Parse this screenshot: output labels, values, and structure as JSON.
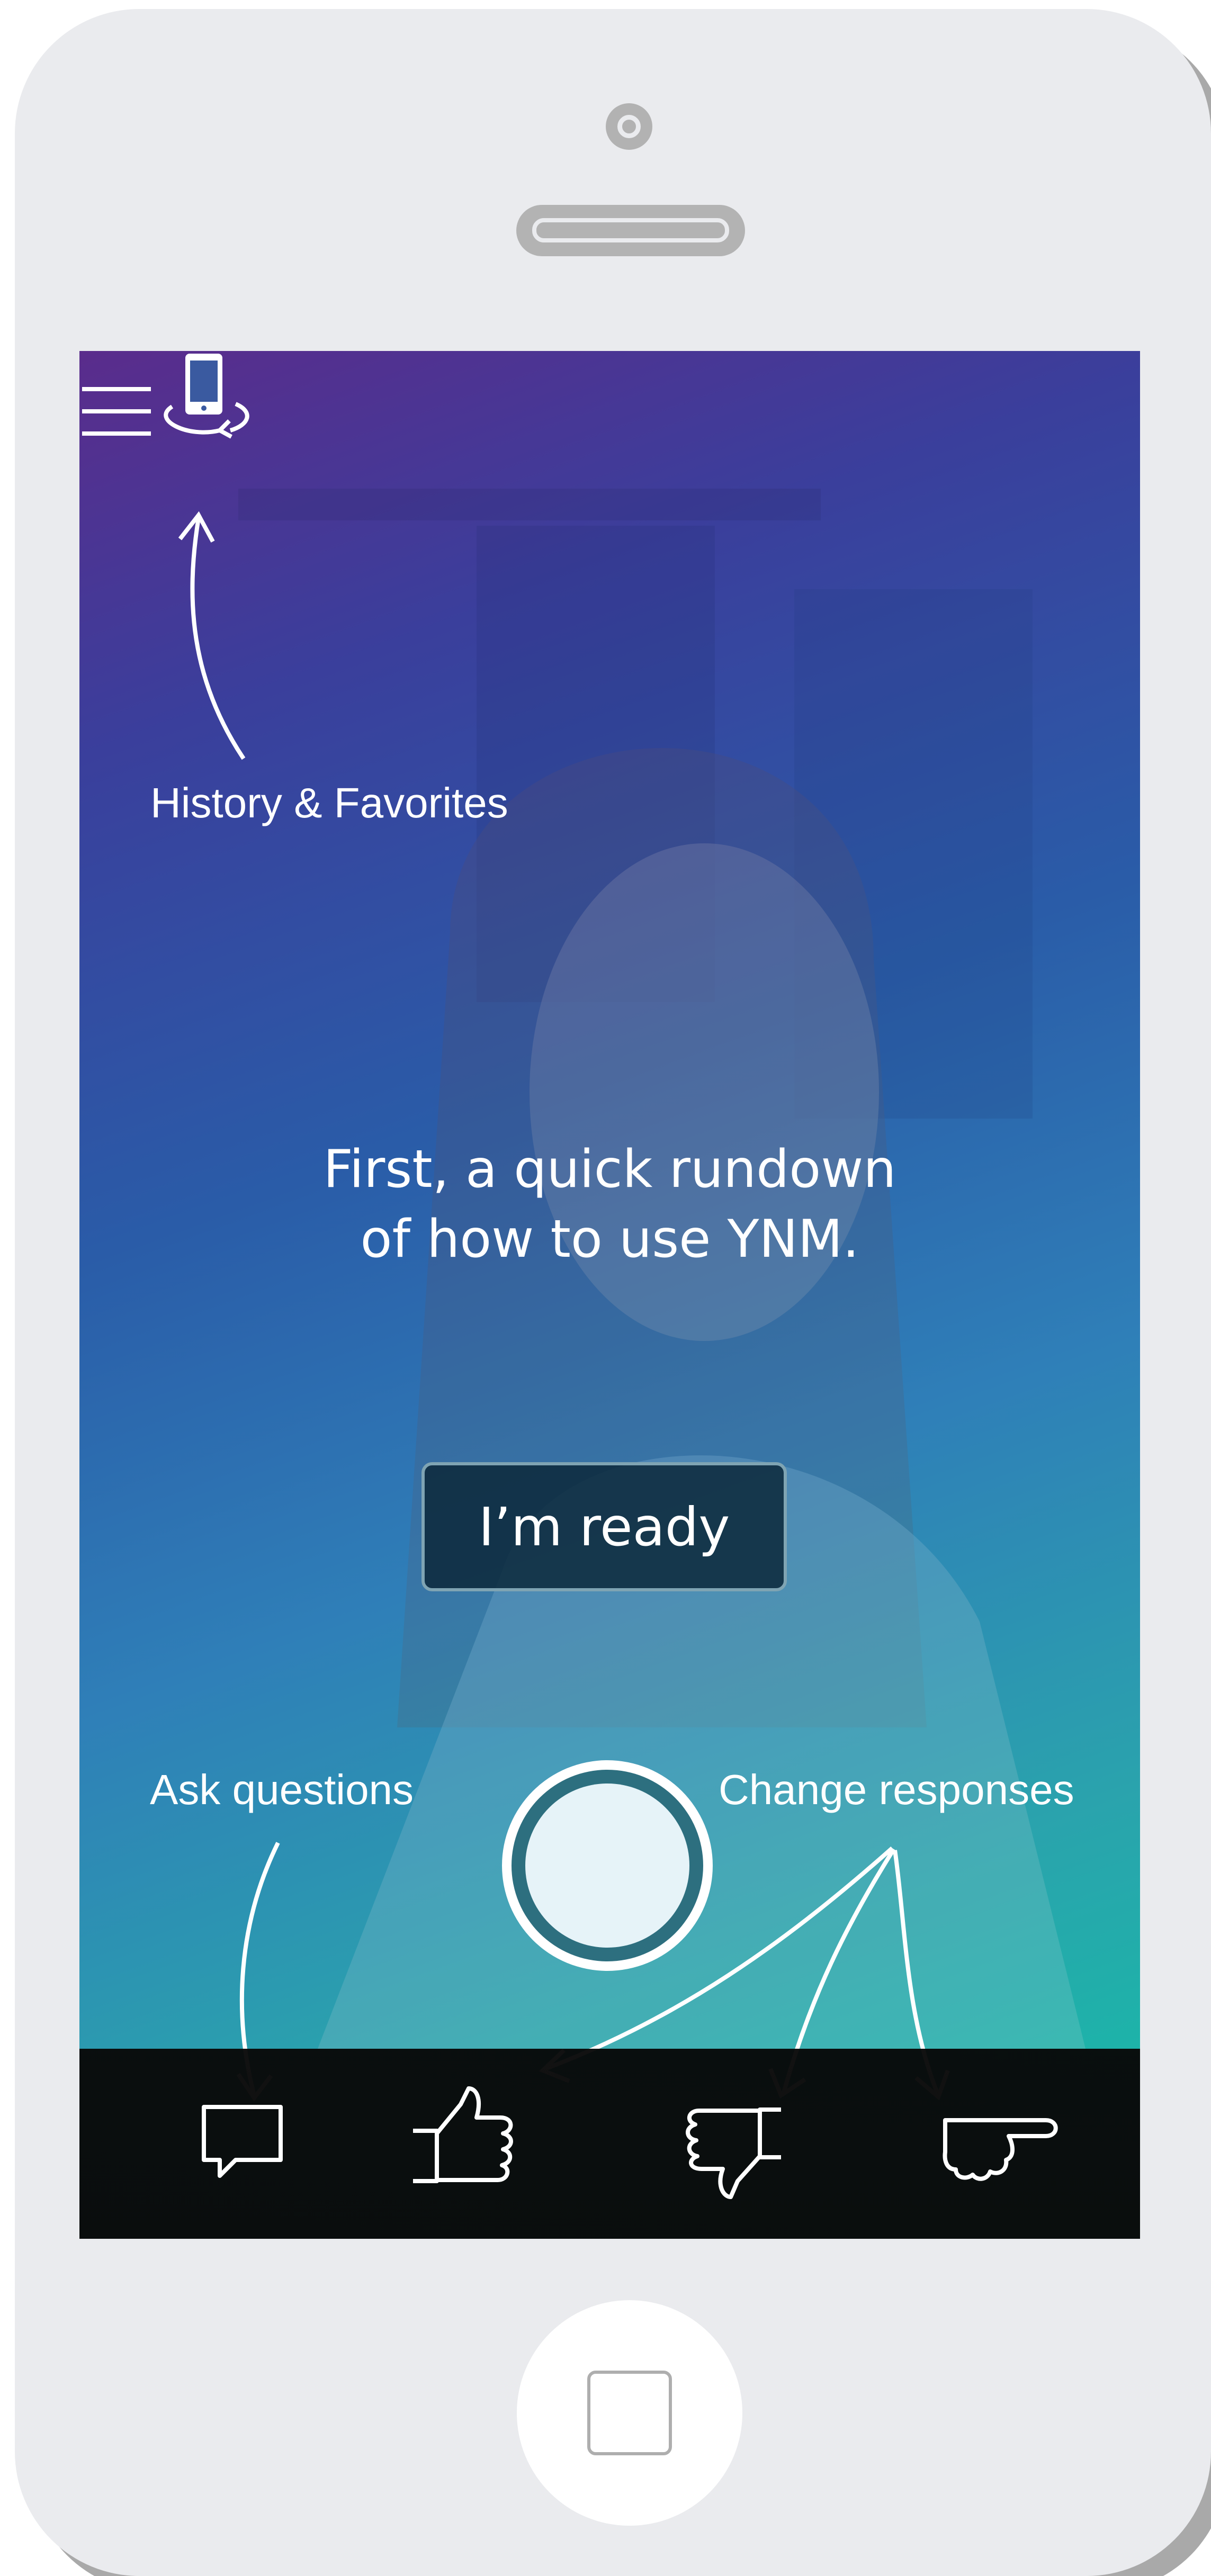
{
  "screen": {
    "history_favorites_label": "History & Favorites",
    "intro_line_1": "First, a quick rundown",
    "intro_line_2": "of how to use YNM.",
    "ready_button_label": "I’m ready",
    "ask_questions_label": "Ask questions",
    "change_responses_label": "Change responses"
  },
  "icons": {
    "menu": "hamburger-menu-icon",
    "flip_camera": "flip-camera-icon",
    "record": "record-button",
    "tabs": [
      "speech-bubble-icon",
      "thumbs-up-icon",
      "thumbs-down-icon",
      "pointing-hand-icon"
    ]
  },
  "colors": {
    "gradient_top": "#5a2c8c",
    "gradient_mid": "#2a5ca8",
    "gradient_bottom": "#14bfa6",
    "phone_body": "#eaebee",
    "bottom_bar": "#0a0a0a"
  }
}
